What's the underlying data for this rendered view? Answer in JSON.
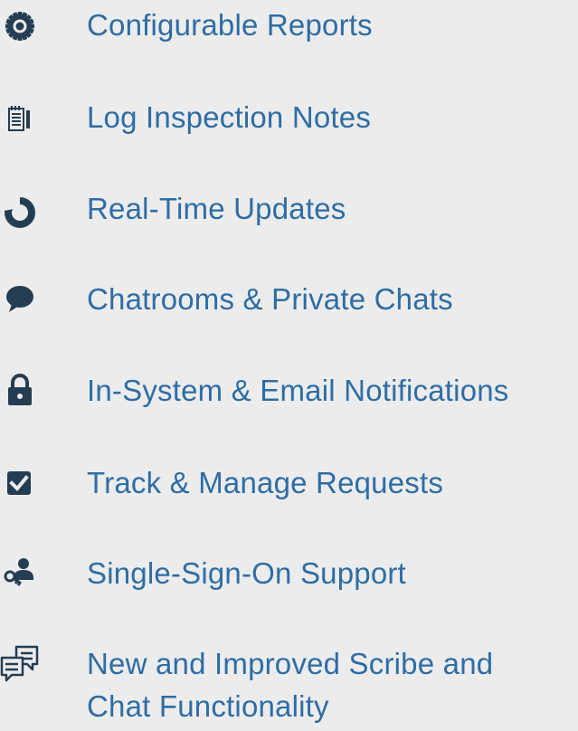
{
  "colors": {
    "background": "#ececec",
    "icon": "#253d52",
    "text": "#2e6da4"
  },
  "features": [
    {
      "label": "Configurable Reports",
      "icon": "gear-icon"
    },
    {
      "label": "Log Inspection Notes",
      "icon": "notepad-icon"
    },
    {
      "label": "Real-Time Updates",
      "icon": "refresh-icon"
    },
    {
      "label": "Chatrooms & Private Chats",
      "icon": "chat-bubble-icon"
    },
    {
      "label": "In-System & Email Notifications",
      "icon": "lock-icon"
    },
    {
      "label": "Track & Manage Requests",
      "icon": "checkbox-icon"
    },
    {
      "label": "Single-Sign-On Support",
      "icon": "user-key-icon"
    },
    {
      "label_line1": "New and Improved Scribe and",
      "label_line2": "Chat Functionality",
      "icon": "chat-bubbles-icon"
    }
  ]
}
